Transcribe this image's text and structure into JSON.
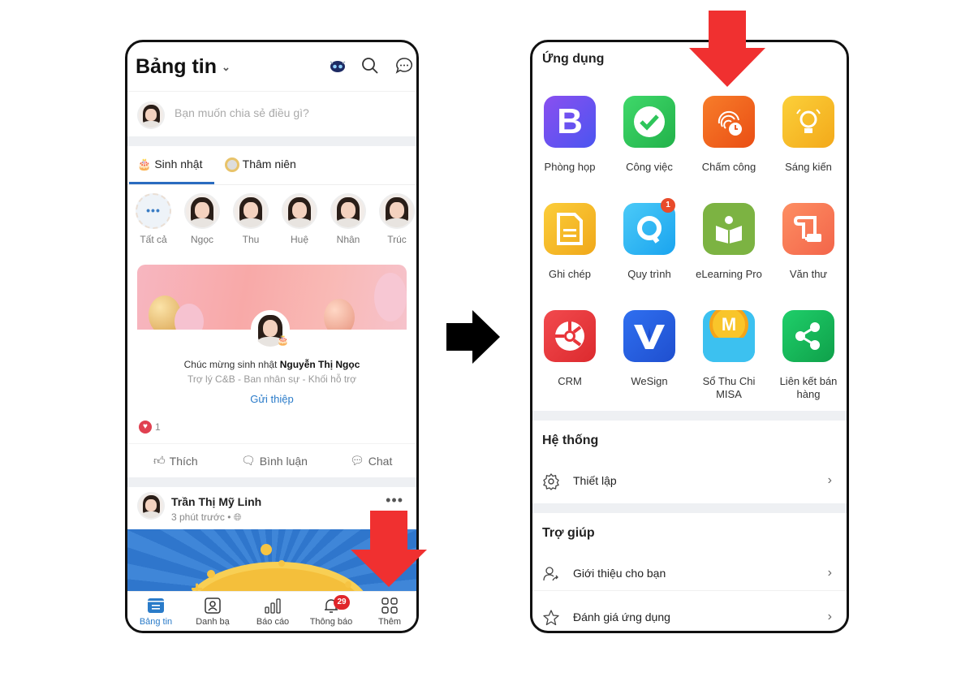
{
  "left_screen": {
    "header": {
      "title": "Bảng tin",
      "icons": [
        "bot-icon",
        "search-icon",
        "chat-icon"
      ]
    },
    "compose": {
      "placeholder": "Bạn muốn chia sẻ điều gì?"
    },
    "tabs": [
      {
        "label": "Sinh nhật",
        "icon": "cake-icon",
        "active": true
      },
      {
        "label": "Thâm niên",
        "icon": "medal-icon",
        "active": false
      }
    ],
    "birthday_people": [
      {
        "name": "Tất cả",
        "type": "all"
      },
      {
        "name": "Ngọc"
      },
      {
        "name": "Thu"
      },
      {
        "name": "Huệ"
      },
      {
        "name": "Nhân"
      },
      {
        "name": "Trúc"
      }
    ],
    "birthday_card": {
      "greeting": "Chúc mừng sinh nhật",
      "person": "Nguyễn Thị Ngọc",
      "role": "Trợ lý C&B - Ban nhân sự - Khối hỗ trợ",
      "action": "Gửi thiệp"
    },
    "reactions": {
      "count": "1"
    },
    "actions": [
      {
        "label": "Thích",
        "icon": "thumbs-up-icon"
      },
      {
        "label": "Bình luận",
        "icon": "comment-icon"
      },
      {
        "label": "Chat",
        "icon": "chat-icon"
      }
    ],
    "post": {
      "author": "Trần Thị Mỹ Linh",
      "time": "3 phút trước •",
      "more": "•••"
    },
    "bottom_nav": [
      {
        "label": "Bảng tin",
        "icon": "newsfeed-icon",
        "active": true
      },
      {
        "label": "Danh bạ",
        "icon": "contacts-icon"
      },
      {
        "label": "Báo cáo",
        "icon": "report-icon"
      },
      {
        "label": "Thông báo",
        "icon": "bell-icon",
        "badge": "29"
      },
      {
        "label": "Thêm",
        "icon": "grid-icon"
      }
    ]
  },
  "right_screen": {
    "apps_title": "Ứng dụng",
    "apps": [
      {
        "label": "Phòng họp",
        "icon": "meeting-room-icon",
        "color": "#6b4ef0"
      },
      {
        "label": "Công việc",
        "icon": "task-check-icon",
        "color": "#2ec55a"
      },
      {
        "label": "Chấm công",
        "icon": "fingerprint-clock-icon",
        "color": "#f2621c"
      },
      {
        "label": "Sáng kiến",
        "icon": "lightbulb-icon",
        "color": "#f5b91e"
      },
      {
        "label": "Ghi chép",
        "icon": "note-icon",
        "color": "#f5b82a"
      },
      {
        "label": "Quy trình",
        "icon": "process-icon",
        "color": "#2fb6f5",
        "badge": "1"
      },
      {
        "label": "eLearning Pro",
        "icon": "elearning-icon",
        "color": "#7cb342"
      },
      {
        "label": "Văn thư",
        "icon": "scroll-icon",
        "color": "#fb7c58"
      },
      {
        "label": "CRM",
        "icon": "crm-icon",
        "color": "#e8353a"
      },
      {
        "label": "WeSign",
        "icon": "wesign-icon",
        "color": "#2a5fe0"
      },
      {
        "label": "Sổ Thu Chi MISA",
        "icon": "misa-coin-icon",
        "color": "#3cc1f0"
      },
      {
        "label": "Liên kết bán hàng",
        "icon": "share-icon",
        "color": "#18b35a"
      }
    ],
    "system": {
      "title": "Hệ thống",
      "items": [
        {
          "label": "Thiết lập",
          "icon": "gear-icon"
        }
      ]
    },
    "help": {
      "title": "Trợ giúp",
      "items": [
        {
          "label": "Giới thiệu cho bạn",
          "icon": "refer-user-icon"
        },
        {
          "label": "Đánh giá ứng dụng",
          "icon": "star-icon"
        }
      ]
    }
  },
  "annotations": {
    "arrow_color": "#f03030",
    "transition_arrow_color": "#000000"
  }
}
